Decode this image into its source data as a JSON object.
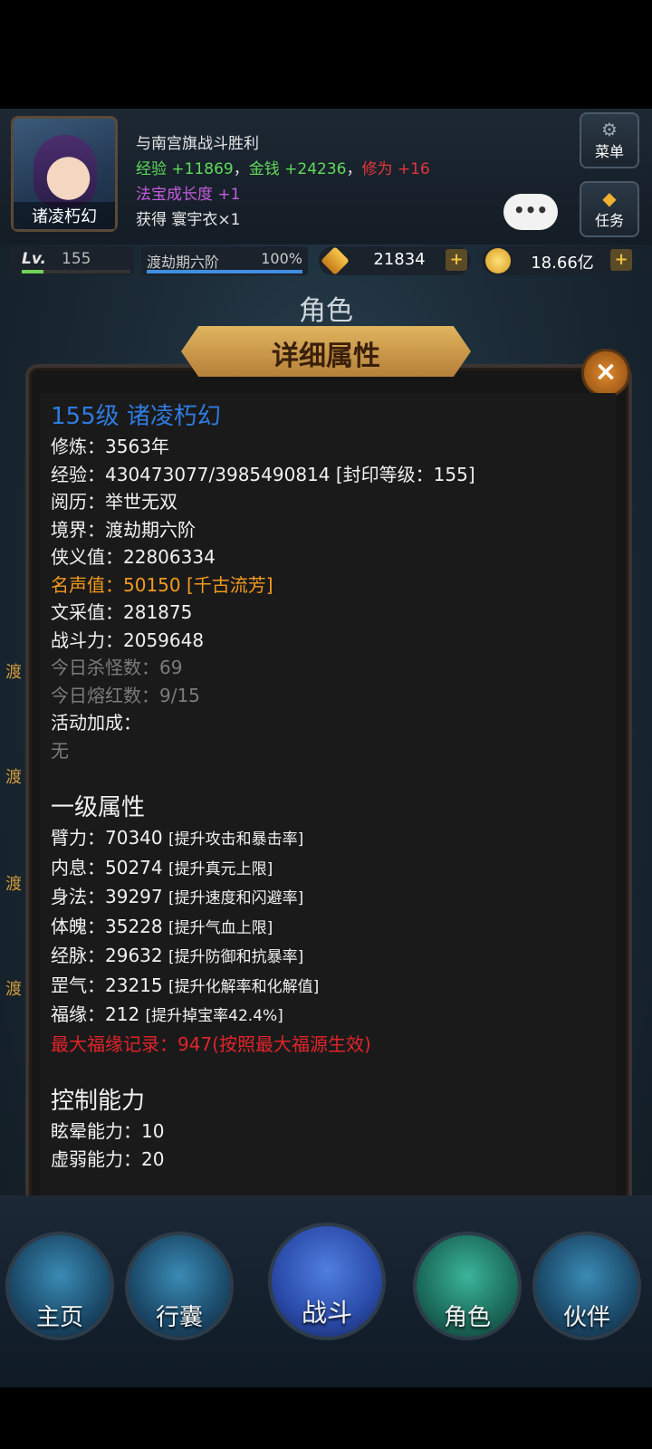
{
  "header": {
    "avatar_name": "诸凌朽幻",
    "messages": {
      "line1": "与南宫旗战斗胜利",
      "exp_label": "经验",
      "exp_value": "+11869",
      "sep1": "，",
      "money_label": "金钱",
      "money_value": "+24236",
      "sep2": "，",
      "cultivation_label": "修为",
      "cultivation_value": "+16",
      "treasure_label": "法宝成长度",
      "treasure_value": "+1",
      "obtain": "获得 寰宇衣×1"
    },
    "chat_bubble": "•••",
    "menu_label": "菜单",
    "task_label": "任务"
  },
  "stats": {
    "lv_label": "Lv.",
    "level": "155",
    "level_progress": 0.2,
    "realm": "渡劫期六阶",
    "realm_pct": "100%",
    "realm_progress": 1.0,
    "gems": "21834",
    "gold": "18.66亿",
    "plus": "+"
  },
  "title": "角色",
  "ribbon": "详细属性",
  "close": "×",
  "bg_labels": [
    "渡",
    "渡",
    "渡",
    "渡"
  ],
  "panel": {
    "name_line": "155级 诸凌朽幻",
    "lines": [
      "修炼：3563年",
      "经验：430473077/3985490814 [封印等级：155]",
      "阅历：举世无双",
      "境界：渡劫期六阶",
      "侠义值：22806334"
    ],
    "fame": "名声值：50150 [千古流芳]",
    "lines2": [
      "文采值：281875",
      "战斗力：2059648"
    ],
    "gray_lines": [
      "今日杀怪数：69",
      "今日熔红数：9/15"
    ],
    "activity": "活动加成：",
    "activity_none": "无",
    "section1": "一级属性",
    "attrs": [
      {
        "k": "臂力：70340 ",
        "d": "[提升攻击和暴击率]"
      },
      {
        "k": "内息：50274 ",
        "d": "[提升真元上限]"
      },
      {
        "k": "身法：39297 ",
        "d": "[提升速度和闪避率]"
      },
      {
        "k": "体魄：35228 ",
        "d": "[提升气血上限]"
      },
      {
        "k": "经脉：29632 ",
        "d": "[提升防御和抗暴率]"
      },
      {
        "k": "罡气：23215 ",
        "d": "[提升化解率和化解值]"
      },
      {
        "k": "福缘：212 ",
        "d": "[提升掉宝率42.4%]"
      }
    ],
    "max_luck": "最大福缘记录：947(按照最大福源生效)",
    "section2": "控制能力",
    "control": [
      "眩晕能力：10",
      "虚弱能力：20"
    ]
  },
  "nav": [
    "主页",
    "行囊",
    "战斗",
    "角色",
    "伙伴"
  ],
  "colors": {
    "blue_name": "#2f7be0",
    "fame_orange": "#f39a1f",
    "warning_red": "#e2242b",
    "exp_green": "#5fdc5a"
  }
}
